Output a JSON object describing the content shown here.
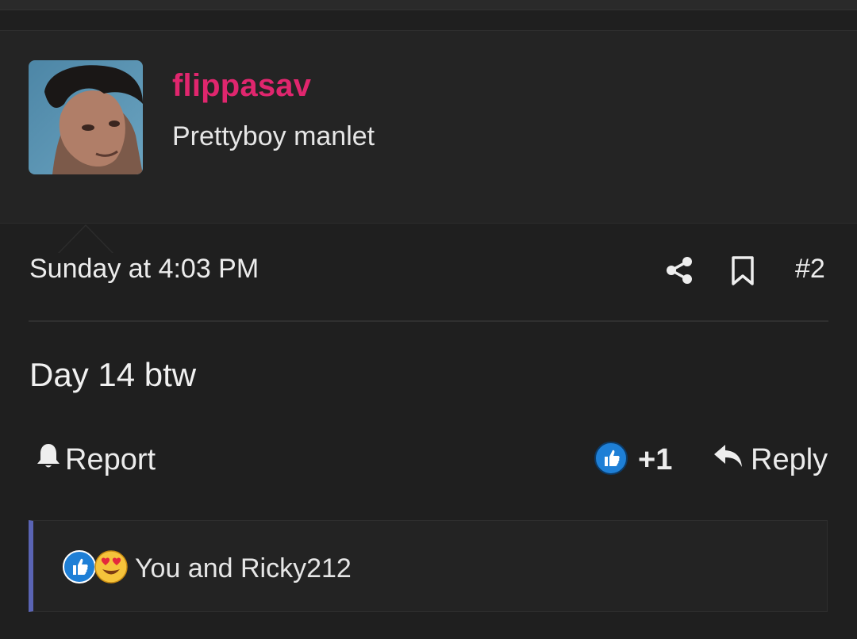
{
  "user": {
    "username": "flippasav",
    "user_title": "Prettyboy manlet",
    "username_color": "#e0266e"
  },
  "post": {
    "date": "Sunday at 4:03 PM",
    "number": "#2",
    "body": "Day 14 btw"
  },
  "actions": {
    "report_label": "Report",
    "like_count": "+1",
    "reply_label": "Reply"
  },
  "reactions": {
    "text": "You and Ricky212",
    "accent_color": "#5a64b4"
  },
  "icons": {
    "share": "share-icon",
    "bookmark": "bookmark-icon",
    "report": "bell-icon",
    "like": "thumbs-up-icon",
    "love": "heart-eyes-emoji-icon",
    "reply": "reply-arrow-icon"
  }
}
